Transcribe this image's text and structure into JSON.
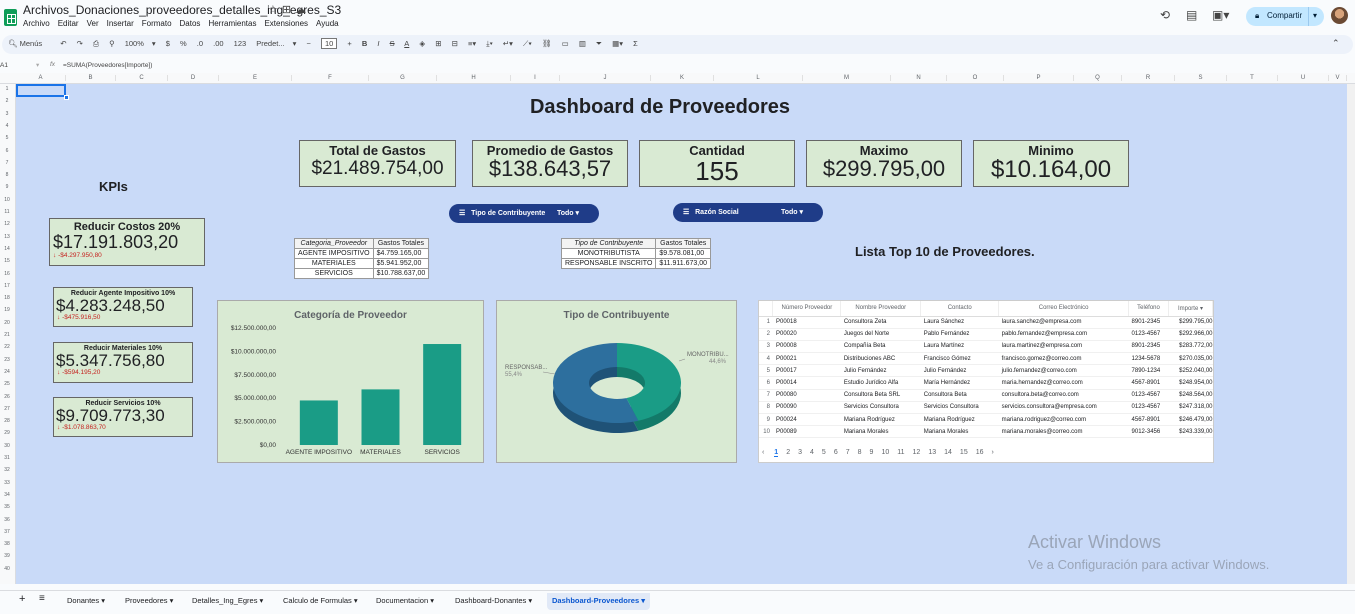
{
  "app": {
    "doc_title": "Archivos_Donaciones_proveedores_detalles_ing_egres_S3",
    "menu": [
      "Archivo",
      "Editar",
      "Ver",
      "Insertar",
      "Formato",
      "Datos",
      "Herramientas",
      "Extensiones",
      "Ayuda"
    ],
    "share_label": "Compartir"
  },
  "toolbar": {
    "menus_label": "Menús",
    "zoom": "100%",
    "currency": "$",
    "percent": "%",
    "dec_dec": ".0",
    "dec_inc": ".00",
    "num_fmt": "123",
    "font": "Predet...",
    "font_size": "10",
    "bold": "B",
    "italic": "I",
    "strike": "S",
    "text_color": "A",
    "sigma": "Σ"
  },
  "formula_bar": {
    "cell_ref": "A1",
    "fx": "fx",
    "formula": "=SUMA(Proveedores[Importe])"
  },
  "columns": [
    "A",
    "B",
    "C",
    "D",
    "E",
    "F",
    "G",
    "H",
    "I",
    "J",
    "K",
    "L",
    "M",
    "N",
    "O",
    "P",
    "Q",
    "R",
    "S",
    "T",
    "U",
    "V"
  ],
  "dashboard": {
    "title": "Dashboard de Proveedores",
    "kpis_label": "KPIs",
    "cards": [
      {
        "label": "Total de Gastos",
        "value": "$21.489.754,00"
      },
      {
        "label": "Promedio de Gastos",
        "value": "$138.643,57"
      },
      {
        "label": "Cantidad",
        "value": "155"
      },
      {
        "label": "Maximo",
        "value": "$299.795,00"
      },
      {
        "label": "Minimo",
        "value": "$10.164,00"
      }
    ],
    "left_cards": [
      {
        "label": "Reducir Costos 20%",
        "value": "$17.191.803,20",
        "delta": "-$4.297.950,80"
      },
      {
        "label": "Reducir Agente Impositivo 10%",
        "value": "$4.283.248,50",
        "delta": "-$475.916,50"
      },
      {
        "label": "Reducir Materiales 10%",
        "value": "$5.347.756,80",
        "delta": "-$594.195,20"
      },
      {
        "label": "Reducir Servicios 10%",
        "value": "$9.709.773,30",
        "delta": "-$1.078.863,70"
      }
    ],
    "filters": [
      {
        "label": "Tipo de Contribuyente",
        "value": "Todo"
      },
      {
        "label": "Razón Social",
        "value": "Todo"
      }
    ],
    "pivot1": {
      "headers": [
        "Categoria_Proveedor",
        "Gastos Totales"
      ],
      "rows": [
        [
          "AGENTE IMPOSITIVO",
          "$4.759.165,00"
        ],
        [
          "MATERIALES",
          "$5.941.952,00"
        ],
        [
          "SERVICIOS",
          "$10.788.637,00"
        ]
      ]
    },
    "pivot2": {
      "headers": [
        "Tipo de Contribuyente",
        "Gastos Totales"
      ],
      "rows": [
        [
          "MONOTRIBUTISTA",
          "$9.578.081,00"
        ],
        [
          "RESPONSABLE INSCRITO",
          "$11.911.673,00"
        ]
      ]
    },
    "top10_label": "Lista Top 10 de Proveedores.",
    "top10": {
      "headers": [
        "Número Proveedor",
        "Nombre Proveedor",
        "Contacto",
        "Correo Electrónico",
        "Teléfono",
        "Importe"
      ],
      "rows": [
        [
          "P00018",
          "Consultora Zeta",
          "Laura Sánchez",
          "laura.sanchez@empresa.com",
          "8901-2345",
          "$299.795,00"
        ],
        [
          "P00020",
          "Juegos del Norte",
          "Pablo Fernández",
          "pablo.fernandez@empresa.com",
          "0123-4567",
          "$292.966,00"
        ],
        [
          "P00008",
          "Compañía Beta",
          "Laura Martínez",
          "laura.martinez@empresa.com",
          "8901-2345",
          "$283.772,00"
        ],
        [
          "P00021",
          "Distribuciones ABC",
          "Francisco Gómez",
          "francisco.gomez@correo.com",
          "1234-5678",
          "$270.035,00"
        ],
        [
          "P00017",
          "Julio Fernández",
          "Julio Fernández",
          "julio.fernandez@correo.com",
          "7890-1234",
          "$252.040,00"
        ],
        [
          "P00014",
          "Estudio Jurídico Alfa",
          "María Hernández",
          "maria.hernandez@correo.com",
          "4567-8901",
          "$248.954,00"
        ],
        [
          "P00080",
          "Consultora Beta SRL",
          "Consultora Beta",
          "consultora.beta@correo.com",
          "0123-4567",
          "$248.564,00"
        ],
        [
          "P00090",
          "Servicios Consultora",
          "Servicios Consultora",
          "servicios.consultora@empresa.com",
          "0123-4567",
          "$247.318,00"
        ],
        [
          "P00024",
          "Mariana Rodríguez",
          "Mariana Rodríguez",
          "mariana.rodriguez@correo.com",
          "4567-8901",
          "$246.479,00"
        ],
        [
          "P00089",
          "Mariana Morales",
          "Mariana Morales",
          "mariana.morales@correo.com",
          "9012-3456",
          "$243.339,00"
        ]
      ],
      "pages": [
        "1",
        "2",
        "3",
        "4",
        "5",
        "6",
        "7",
        "8",
        "9",
        "10",
        "11",
        "12",
        "13",
        "14",
        "15",
        "16"
      ]
    }
  },
  "chart_data": [
    {
      "type": "bar",
      "title": "Categoría de Proveedor",
      "categories": [
        "AGENTE IMPOSITIVO",
        "MATERIALES",
        "SERVICIOS"
      ],
      "values": [
        4759165,
        5941952,
        10788637
      ],
      "ylim": [
        0,
        12500000
      ],
      "yticks": [
        "$0,00",
        "$2.500.000,00",
        "$5.000.000,00",
        "$7.500.000,00",
        "$10.000.000,00",
        "$12.500.000,00"
      ],
      "color": "#1a9c86"
    },
    {
      "type": "pie",
      "title": "Tipo de Contribuyente",
      "labels": [
        "MONOTRIBU...",
        "RESPONSAB..."
      ],
      "values": [
        44.6,
        55.4
      ],
      "pct_labels": [
        "44,6%",
        "55,4%"
      ],
      "colors": [
        "#1a9c86",
        "#2d6f9e"
      ]
    }
  ],
  "watermark": {
    "line1": "Activar Windows",
    "line2": "Ve a Configuración para activar Windows."
  },
  "sheets": [
    "Donantes",
    "Proveedores",
    "Detalles_Ing_Egres",
    "Calculo de Formulas",
    "Documentacion",
    "Dashboard-Donantes",
    "Dashboard-Proveedores"
  ],
  "active_sheet": "Dashboard-Proveedores"
}
